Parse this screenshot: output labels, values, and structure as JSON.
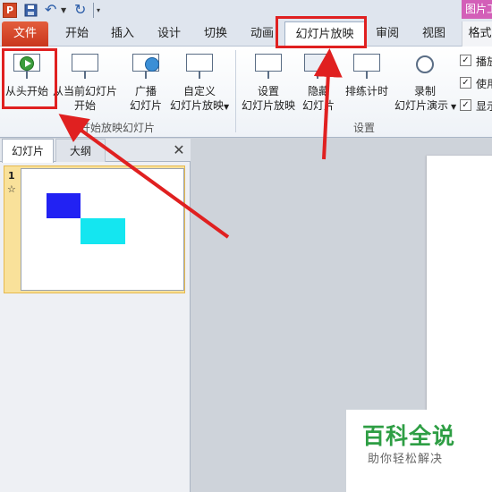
{
  "quick_access": {
    "app_icon_letter": "P",
    "save_icon": "save-icon",
    "undo_icon": "undo-icon",
    "redo_icon": "redo-icon",
    "context_title": "图片工"
  },
  "tabs": {
    "file": "文件",
    "home": "开始",
    "insert": "插入",
    "design": "设计",
    "transitions": "切换",
    "animations": "动画",
    "slideshow": "幻灯片放映",
    "review": "审阅",
    "view": "视图",
    "format": "格式"
  },
  "ribbon": {
    "start_group": {
      "from_beginning": "从头开始",
      "from_current_line1": "从当前幻灯片",
      "from_current_line2": "开始",
      "broadcast_line1": "广播",
      "broadcast_line2": "幻灯片",
      "custom_line1": "自定义",
      "custom_line2": "幻灯片放映",
      "label": "开始放映幻灯片"
    },
    "setup_group": {
      "setup_line1": "设置",
      "setup_line2": "幻灯片放映",
      "hide_line1": "隐藏",
      "hide_line2": "幻灯片",
      "rehearse": "排练计时",
      "record_line1": "录制",
      "record_line2": "幻灯片演示",
      "label": "设置",
      "checkbox_play": "播放",
      "checkbox_use": "使用",
      "checkbox_show": "显示"
    }
  },
  "panel": {
    "tab_slides": "幻灯片",
    "tab_outline": "大纲",
    "close": "✕",
    "slide_number": "1",
    "star": "☆"
  },
  "watermark": {
    "title": "百科全说",
    "subtitle": "助你轻松解决"
  },
  "colors": {
    "file_tab": "#d8442b",
    "highlight": "#e02020",
    "shape_blue": "#2222f3",
    "shape_cyan": "#14e6f0",
    "watermark_green": "#2e9e44"
  }
}
